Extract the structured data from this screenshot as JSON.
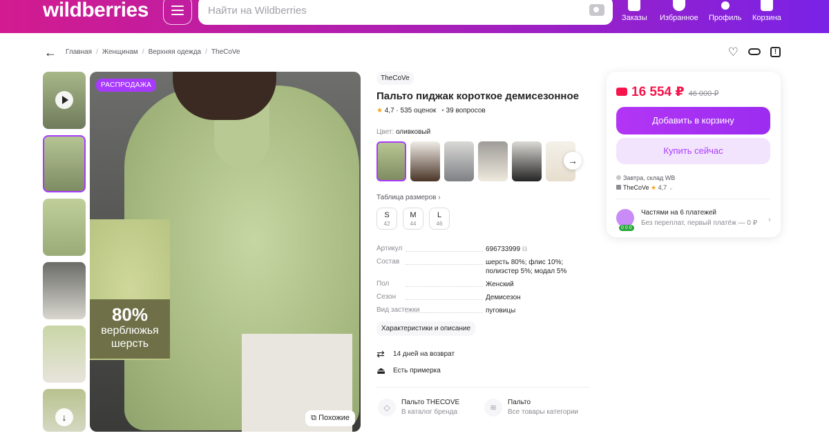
{
  "header": {
    "logo": "wildberries",
    "search_placeholder": "Найти на Wildberries",
    "nav": [
      {
        "label": "Заказы",
        "icon": "box-icon"
      },
      {
        "label": "Избранное",
        "icon": "heart-icon"
      },
      {
        "label": "Профиль",
        "icon": "user-icon"
      },
      {
        "label": "Корзина",
        "icon": "cart-icon"
      }
    ]
  },
  "breadcrumb": [
    "Главная",
    "Женщинам",
    "Верхняя одежда",
    "TheCoVe"
  ],
  "gallery": {
    "sale_badge": "РАСПРОДАЖА",
    "camel_big": "80%",
    "camel_line1": "верблюжья",
    "camel_line2": "шерсть",
    "similar": "Похожие"
  },
  "product": {
    "brand": "TheCoVe",
    "title": "Пальто пиджак короткое демисезонное",
    "rating": "4,7",
    "reviews": "535 оценок",
    "questions": "39 вопросов",
    "color_label": "Цвет:",
    "color_value": "оливковый",
    "size_table": "Таблица размеров",
    "sizes": [
      {
        "size": "S",
        "ru": "42"
      },
      {
        "size": "M",
        "ru": "44"
      },
      {
        "size": "L",
        "ru": "46"
      }
    ],
    "specs": [
      {
        "key": "Артикул",
        "value": "696733999"
      },
      {
        "key": "Состав",
        "value": "шерсть 80%; флис 10%; полиэстер 5%; модал 5%"
      },
      {
        "key": "Пол",
        "value": "Женский"
      },
      {
        "key": "Сезон",
        "value": "Демисезон"
      },
      {
        "key": "Вид застежки",
        "value": "пуговицы"
      }
    ],
    "chars_button": "Характеристики и описание",
    "return_text": "14 дней на возврат",
    "fitting_text": "Есть примерка",
    "brand_link_title": "Пальто THECOVE",
    "brand_link_sub": "В каталог бренда",
    "cat_link_title": "Пальто",
    "cat_link_sub": "Все товары категории"
  },
  "price_card": {
    "price": "16 554 ₽",
    "old_price": "46 000 ₽",
    "add_to_cart": "Добавить в корзину",
    "buy_now": "Купить сейчас",
    "delivery": "Завтра, склад WB",
    "seller": "TheCoVe",
    "seller_rating": "4,7",
    "installments_title": "Частями на 6 платежей",
    "installments_sub": "Без переплат, первый платёж — 0 ₽",
    "installments_badge": "0 0 0"
  },
  "colors": {
    "accent": "#a73afd",
    "price": "#f5144b",
    "star": "#ff9f0e"
  }
}
